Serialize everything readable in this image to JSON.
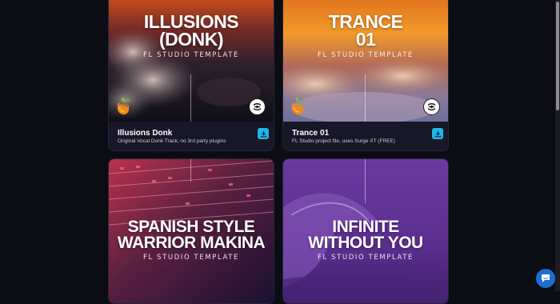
{
  "cards": [
    {
      "title_line1": "ILLUSIONS",
      "title_line2": "(DONK)",
      "subtitle": "FL STUDIO TEMPLATE",
      "name": "Illusions Donk",
      "description": "Original Vocal Donk Track, no 3rd party plugins"
    },
    {
      "title_line1": "TRANCE",
      "title_line2": "01",
      "subtitle": "FL STUDIO TEMPLATE",
      "name": "Trance 01",
      "description": "FL Studio project file, uses Surge XT (FREE)"
    },
    {
      "title_line1": "SPANISH STYLE",
      "title_line2": "WARRIOR MAKINA",
      "subtitle": "FL STUDIO TEMPLATE"
    },
    {
      "title_line1": "INFINITE",
      "title_line2": "WITHOUT YOU",
      "subtitle": "FL STUDIO TEMPLATE"
    }
  ],
  "icons": {
    "download": "download-icon",
    "chat": "chat-icon",
    "fruit": "fl-studio-logo-icon",
    "emblem": "brand-emblem-icon"
  },
  "colors": {
    "page_background": "#0c0c14",
    "card_info_background": "#171728",
    "download_button": "#1fb7ea",
    "chat_button": "#1b6fd1"
  }
}
